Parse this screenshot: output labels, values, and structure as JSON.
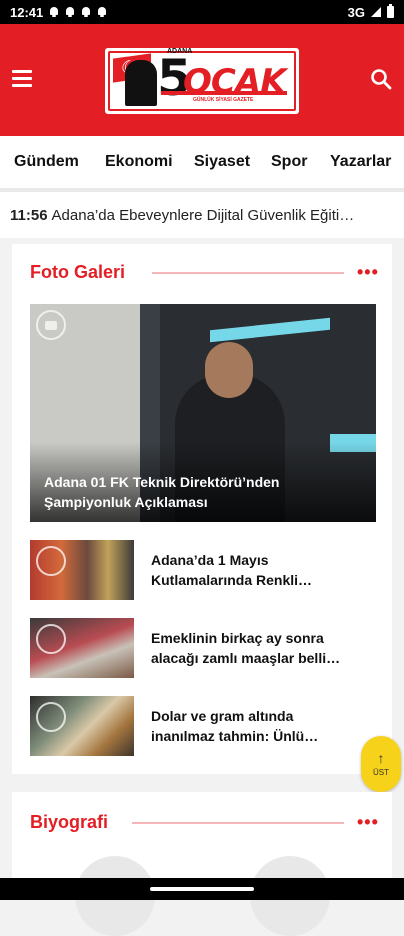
{
  "status_bar": {
    "time": "12:41",
    "network": "3G"
  },
  "header": {
    "logo_top": "ADANA",
    "logo_number": "5",
    "logo_word": "OCAK",
    "logo_sub": "GÜNLÜK SİYASİ GAZETE"
  },
  "nav": {
    "items": [
      "Gündem",
      "Ekonomi",
      "Siyaset",
      "Spor",
      "Yazarlar"
    ]
  },
  "ticker": {
    "time": "11:56",
    "text": "Adana’da Ebeveynlere Dijital Güvenlik Eğiti…"
  },
  "photo_gallery": {
    "title": "Foto Galeri",
    "more": "•••",
    "featured_caption": "Adana 01 FK Teknik Direktörü’nden Şampiyonluk Açıklaması",
    "items": [
      {
        "title": "Adana’da 1 Mayıs\nKutlamalarında Renkli…"
      },
      {
        "title": "Emeklinin birkaç ay sonra\nalacağı zamlı maaşlar belli…"
      },
      {
        "title": "Dolar ve gram altında\ninanılmaz tahmin: Ünlü…"
      }
    ]
  },
  "scroll_top": {
    "arrow": "↑",
    "label": "ÜST"
  },
  "biography": {
    "title": "Biyografi",
    "more": "•••"
  },
  "colors": {
    "brand_red": "#e31e24",
    "scroll_button": "#f7d21a"
  }
}
